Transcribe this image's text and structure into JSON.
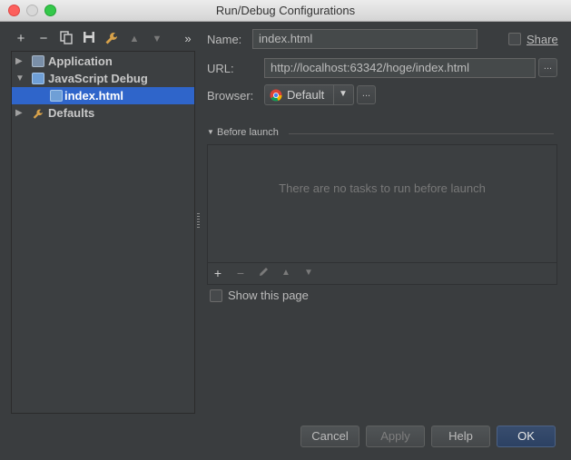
{
  "window": {
    "title": "Run/Debug Configurations"
  },
  "toolbar": {
    "add": "+",
    "remove": "−",
    "more": "»"
  },
  "tree": {
    "items": [
      {
        "label": "Application",
        "expanded": false
      },
      {
        "label": "JavaScript Debug",
        "expanded": true
      },
      {
        "label": "index.html",
        "selected": true
      },
      {
        "label": "Defaults",
        "expanded": false
      }
    ]
  },
  "form": {
    "name_label": "Name:",
    "name_value": "index.html",
    "share_label": "Share",
    "url_label": "URL:",
    "url_value": "http://localhost:63342/hoge/index.html",
    "browser_label": "Browser:",
    "browser_value": "Default",
    "ellipsis": "...",
    "before_launch_label": "Before launch",
    "no_tasks_text": "There are no tasks to run before launch",
    "show_page_label": "Show this page"
  },
  "buttons": {
    "cancel": "Cancel",
    "apply": "Apply",
    "help": "Help",
    "ok": "OK"
  },
  "colors": {
    "selection": "#2f65ca",
    "background": "#3a3d3f",
    "primary_button": "#2c4163"
  }
}
